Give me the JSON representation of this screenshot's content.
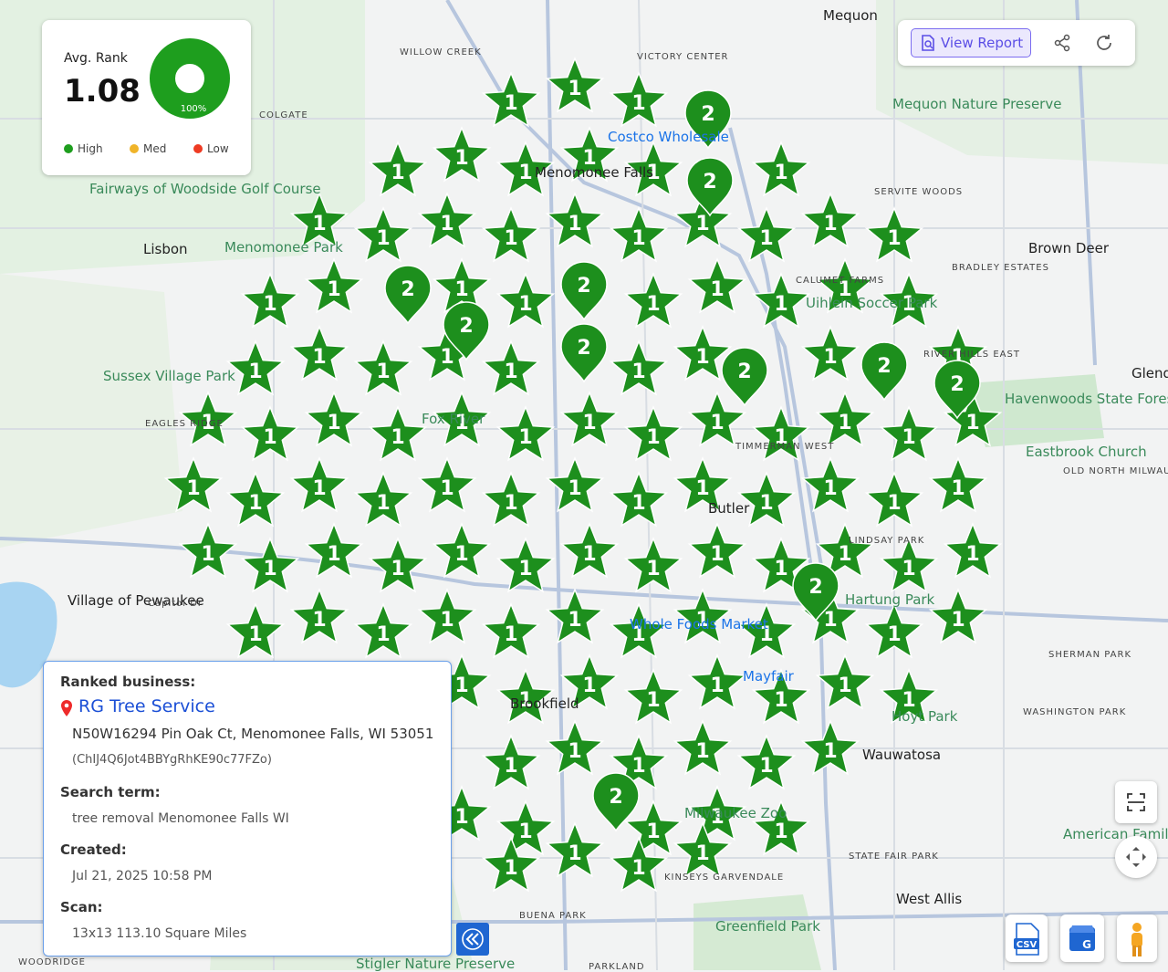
{
  "rank_card": {
    "title": "Avg. Rank",
    "value": "1.08",
    "percent": "100%",
    "percent_value": 100,
    "legend": [
      {
        "label": "High",
        "color": "#1e9e1e"
      },
      {
        "label": "Med",
        "color": "#f0b429"
      },
      {
        "label": "Low",
        "color": "#ee3b23"
      }
    ]
  },
  "toolbar": {
    "view_report_label": "View Report",
    "share_icon": "share-icon",
    "refresh_icon": "refresh-icon"
  },
  "info": {
    "ranked_business_label": "Ranked business:",
    "business_name": "RG Tree Service",
    "address": "N50W16294 Pin Oak Ct, Menomonee Falls, WI 53051",
    "place_id": "(ChIJ4Q6Jot4BBYgRhKE90c77FZo)",
    "search_term_label": "Search term:",
    "search_term": "tree removal Menomonee Falls WI",
    "created_label": "Created:",
    "created": "Jul 21, 2025 10:58 PM",
    "scan_label": "Scan:",
    "scan": "13x13 113.10 Square Miles"
  },
  "buttons": {
    "csv": "CSV",
    "gbp": "G"
  },
  "map_labels": [
    {
      "text": "Mequon",
      "cls": "lbl-city"
    },
    {
      "text": "WILLOW CREEK",
      "cls": "lbl-hood"
    },
    {
      "text": "VICTORY CENTER",
      "cls": "lbl-hood"
    },
    {
      "text": "COLGATE",
      "cls": "lbl-hood"
    },
    {
      "text": "Mequon Nature Preserve",
      "cls": "lbl-park"
    },
    {
      "text": "Costco Wholesale",
      "cls": "lbl-poi"
    },
    {
      "text": "Menomonee Falls",
      "cls": "lbl-city"
    },
    {
      "text": "Fairways of Woodside Golf Course",
      "cls": "lbl-park"
    },
    {
      "text": "SERVITE WOODS",
      "cls": "lbl-hood"
    },
    {
      "text": "Brown Deer",
      "cls": "lbl-city"
    },
    {
      "text": "BRADLEY ESTATES",
      "cls": "lbl-hood"
    },
    {
      "text": "Lisbon",
      "cls": "lbl-city"
    },
    {
      "text": "Menomonee Park",
      "cls": "lbl-park"
    },
    {
      "text": "CALUMET FARMS",
      "cls": "lbl-hood"
    },
    {
      "text": "Uihlein Soccer Park",
      "cls": "lbl-park"
    },
    {
      "text": "RIVER HILLS EAST",
      "cls": "lbl-hood"
    },
    {
      "text": "Sussex Village Park",
      "cls": "lbl-park"
    },
    {
      "text": "Glendale",
      "cls": "lbl-city"
    },
    {
      "text": "Havenwoods State Forest",
      "cls": "lbl-park"
    },
    {
      "text": "EAGLES RIDGE",
      "cls": "lbl-hood"
    },
    {
      "text": "Fox River",
      "cls": "lbl-park"
    },
    {
      "text": "Eastbrook Church",
      "cls": "lbl-park"
    },
    {
      "text": "OLD NORTH MILWAUKEE",
      "cls": "lbl-hood"
    },
    {
      "text": "TIMMERMAN WEST",
      "cls": "lbl-hood"
    },
    {
      "text": "Butler",
      "cls": "lbl-city"
    },
    {
      "text": "LINDSAY PARK",
      "cls": "lbl-hood"
    },
    {
      "text": "Village of Pewaukee",
      "cls": "lbl-city"
    },
    {
      "text": "Capitol Dr",
      "cls": "lbl-hood"
    },
    {
      "text": "Hartung Park",
      "cls": "lbl-park"
    },
    {
      "text": "Whole Foods Market",
      "cls": "lbl-poi"
    },
    {
      "text": "Mayfair",
      "cls": "lbl-poi"
    },
    {
      "text": "SHERMAN PARK",
      "cls": "lbl-hood"
    },
    {
      "text": "Brookfield",
      "cls": "lbl-city"
    },
    {
      "text": "Hoyt Park",
      "cls": "lbl-park"
    },
    {
      "text": "Wauwatosa",
      "cls": "lbl-city"
    },
    {
      "text": "WASHINGTON PARK",
      "cls": "lbl-hood"
    },
    {
      "text": "Milwaukee Zoo",
      "cls": "lbl-park"
    },
    {
      "text": "American Family",
      "cls": "lbl-park"
    },
    {
      "text": "STATE FAIR PARK",
      "cls": "lbl-hood"
    },
    {
      "text": "KINSEYS GARVENDALE",
      "cls": "lbl-hood"
    },
    {
      "text": "West Allis",
      "cls": "lbl-city"
    },
    {
      "text": "BUENA PARK",
      "cls": "lbl-hood"
    },
    {
      "text": "Greenfield Park",
      "cls": "lbl-park"
    },
    {
      "text": "Stigler Nature Preserve",
      "cls": "lbl-park"
    },
    {
      "text": "PARKLAND",
      "cls": "lbl-hood"
    },
    {
      "text": "WOODRIDGE",
      "cls": "lbl-hood"
    }
  ],
  "markers_rank1_count": 157,
  "markers_rank2": [
    "2",
    "2",
    "2",
    "2",
    "2",
    "2",
    "2",
    "2",
    "2",
    "2",
    "2",
    "2"
  ],
  "markers_rank1_label": "1",
  "colors": {
    "marker": "#1d8f1d",
    "marker_dark": "#147314",
    "accent": "#5b4ee6",
    "link": "#1b4fd6"
  }
}
